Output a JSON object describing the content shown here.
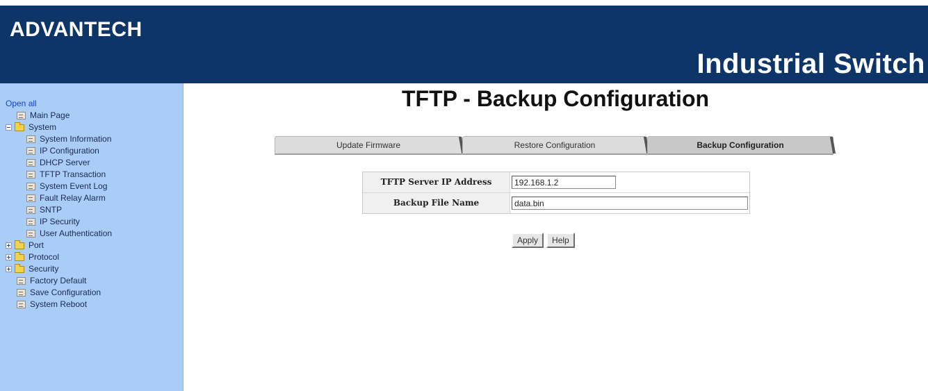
{
  "header": {
    "logo": "ADVANTECH",
    "product": "Industrial Switch"
  },
  "sidebar": {
    "open_all": "Open all",
    "items": [
      {
        "label": "Main Page",
        "kind": "page",
        "level": 1
      },
      {
        "label": "System",
        "kind": "folder",
        "level": 0,
        "expanded": true
      },
      {
        "label": "System Information",
        "kind": "page",
        "level": 2
      },
      {
        "label": "IP Configuration",
        "kind": "page",
        "level": 2
      },
      {
        "label": "DHCP Server",
        "kind": "page",
        "level": 2
      },
      {
        "label": "TFTP Transaction",
        "kind": "page",
        "level": 2
      },
      {
        "label": "System Event Log",
        "kind": "page",
        "level": 2
      },
      {
        "label": "Fault Relay Alarm",
        "kind": "page",
        "level": 2
      },
      {
        "label": "SNTP",
        "kind": "page",
        "level": 2
      },
      {
        "label": "IP Security",
        "kind": "page",
        "level": 2
      },
      {
        "label": "User Authentication",
        "kind": "page",
        "level": 2
      },
      {
        "label": "Port",
        "kind": "folder",
        "level": 0,
        "expanded": false
      },
      {
        "label": "Protocol",
        "kind": "folder",
        "level": 0,
        "expanded": false
      },
      {
        "label": "Security",
        "kind": "folder",
        "level": 0,
        "expanded": false
      },
      {
        "label": "Factory Default",
        "kind": "page",
        "level": 1
      },
      {
        "label": "Save Configuration",
        "kind": "page",
        "level": 1
      },
      {
        "label": "System Reboot",
        "kind": "page",
        "level": 1
      }
    ]
  },
  "main": {
    "title": "TFTP - Backup Configuration",
    "tabs": [
      {
        "label": "Update Firmware",
        "active": false
      },
      {
        "label": "Restore Configuration",
        "active": false
      },
      {
        "label": "Backup Configuration",
        "active": true
      }
    ],
    "form": {
      "server_ip_label": "TFTP Server IP Address",
      "server_ip_value": "192.168.1.2",
      "file_name_label": "Backup File Name",
      "file_name_value": "data.bin"
    },
    "buttons": {
      "apply": "Apply",
      "help": "Help"
    }
  },
  "colors": {
    "header_bg": "#0e3568",
    "sidebar_bg": "#a9cdf7",
    "link": "#1544c9"
  }
}
